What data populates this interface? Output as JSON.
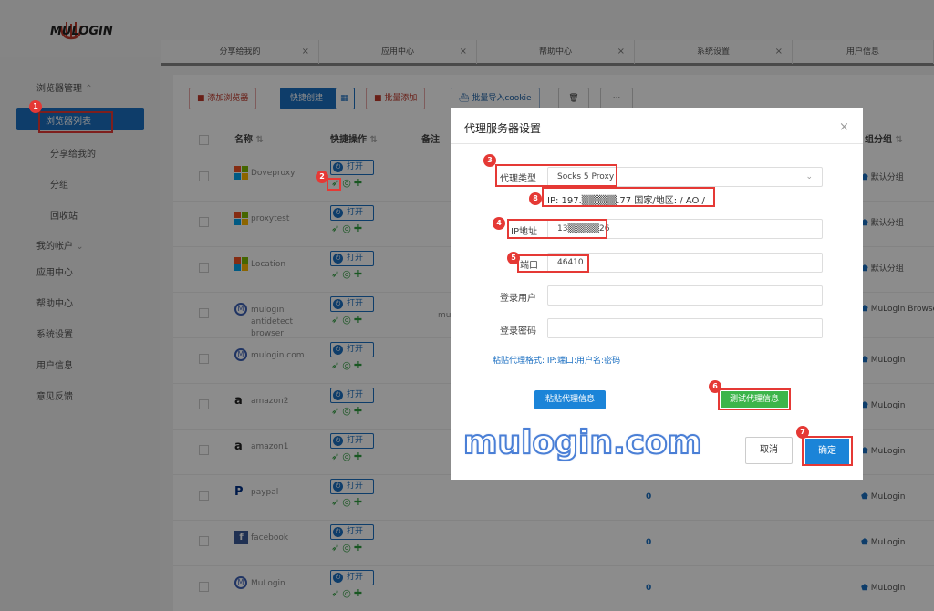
{
  "app": {
    "logo_text": "MULOGIN"
  },
  "sidebar": {
    "browser_mgmt": "浏览器管理",
    "items": [
      "浏览器列表",
      "分享给我的",
      "分组",
      "回收站"
    ],
    "my_account": "我的帐户",
    "more": [
      "应用中心",
      "帮助中心",
      "系统设置",
      "用户信息",
      "意见反馈"
    ]
  },
  "tabs": [
    "分享给我的",
    "应用中心",
    "帮助中心",
    "系统设置",
    "用户信息"
  ],
  "toolbar": {
    "add_browser": "添加浏览器",
    "quick_create": "快捷创建",
    "batch_add": "批量添加",
    "import_cookie": "批量导入cookie"
  },
  "table": {
    "headers": {
      "name": "名称",
      "quick_ops": "快捷操作",
      "note": "备注",
      "group": "组分组"
    },
    "open_label": "打开",
    "rows": [
      {
        "name": "Doveproxy",
        "group": "默认分组"
      },
      {
        "name": "proxytest",
        "group": "默认分组"
      },
      {
        "name": "Location",
        "group": "默认分组"
      },
      {
        "name": "mulogin antidetect browser",
        "note": "mu",
        "group": "MuLogin Browser"
      },
      {
        "name": "mulogin.com",
        "group": "MuLogin"
      },
      {
        "name": "amazon2",
        "group": "MuLogin"
      },
      {
        "name": "amazon1",
        "group": "MuLogin"
      },
      {
        "name": "paypal",
        "zero": "0",
        "group": "MuLogin"
      },
      {
        "name": "facebook",
        "zero": "0",
        "group": "MuLogin"
      },
      {
        "name": "MuLogin",
        "zero": "0",
        "group": "MuLogin"
      }
    ]
  },
  "dialog": {
    "title": "代理服务器设置",
    "proxy_type_label": "代理类型",
    "proxy_type_value": "Socks 5 Proxy",
    "ip_info": "IP: 197.▒▒▒▒▒.77    国家/地区: / AO /",
    "ip_label": "IP地址",
    "ip_value": "13▒▒▒▒▒26",
    "port_label": "端口",
    "port_value": "46410",
    "user_label": "登录用户",
    "pass_label": "登录密码",
    "paste_hint": "粘贴代理格式: IP:端口:用户名:密码",
    "paste_button": "粘贴代理信息",
    "test_button": "测试代理信息",
    "cancel_button": "取消",
    "ok_button": "确定"
  },
  "watermark": "mulogin.com",
  "badges": [
    "1",
    "2",
    "3",
    "4",
    "5",
    "6",
    "7",
    "8"
  ]
}
